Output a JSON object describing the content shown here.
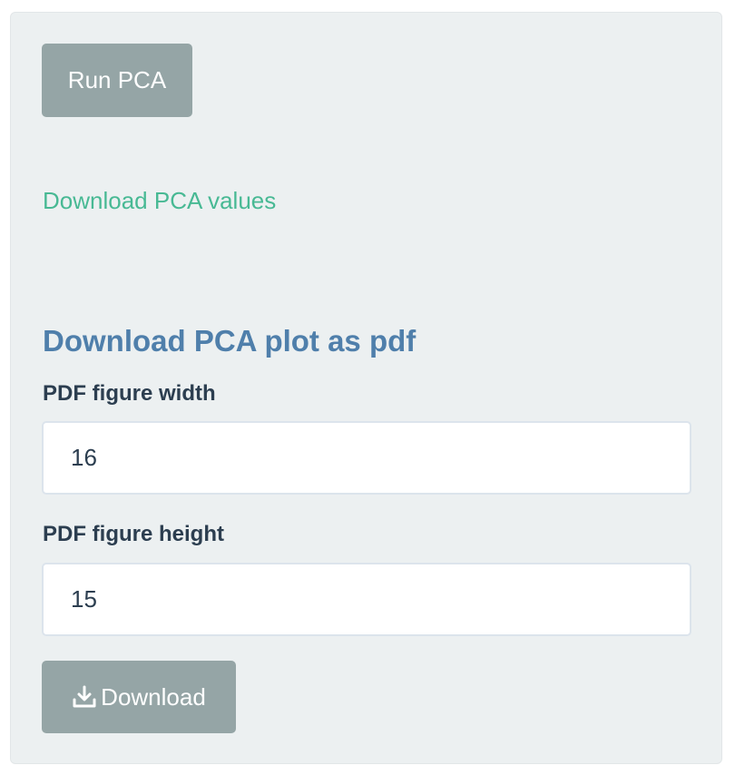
{
  "run_button": {
    "label": "Run PCA"
  },
  "download_values_link": {
    "label": "Download PCA values"
  },
  "pdf_section": {
    "title": "Download PCA plot as pdf",
    "width_field": {
      "label": "PDF figure width",
      "value": "16"
    },
    "height_field": {
      "label": "PDF figure height",
      "value": "15"
    },
    "download_button": {
      "label": "Download",
      "icon": "download-icon"
    }
  },
  "colors": {
    "panel_background": "#ecf0f1",
    "button": "#95a5a6",
    "link": "#48b994",
    "section_title": "#4f7fab",
    "label_text": "#2c3e50"
  }
}
